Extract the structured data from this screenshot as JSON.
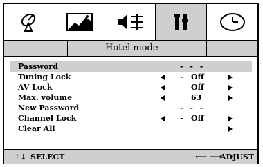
{
  "tabs": [
    {
      "icon": "satellite-dish-icon"
    },
    {
      "icon": "picture-icon"
    },
    {
      "icon": "audio-equalizer-icon"
    },
    {
      "icon": "tools-icon",
      "active": true
    },
    {
      "icon": "clock-icon"
    }
  ],
  "header": {
    "title": "Hotel mode"
  },
  "menu": {
    "items": [
      {
        "label": "Password",
        "value": "- - - -",
        "arrows": false
      },
      {
        "label": "Tuning Lock",
        "value": "Off",
        "arrows": true
      },
      {
        "label": "AV Lock",
        "value": "Off",
        "arrows": true
      },
      {
        "label": "Max. volume",
        "value": "63",
        "arrows": true
      },
      {
        "label": "New Password",
        "value": "- - - -",
        "arrows": false
      },
      {
        "label": "Channel Lock",
        "value": "Off",
        "arrows": true
      },
      {
        "label": "Clear All",
        "value": "",
        "arrows": false
      }
    ]
  },
  "footer": {
    "select_label": "SELECT",
    "adjust_label": "ADJUST",
    "nav_glyph": "↑↓",
    "lr_glyph": "⟵ ⟶"
  },
  "colors": {
    "highlight": "#cfcfcf",
    "text": "#000000",
    "background": "#ffffff"
  }
}
